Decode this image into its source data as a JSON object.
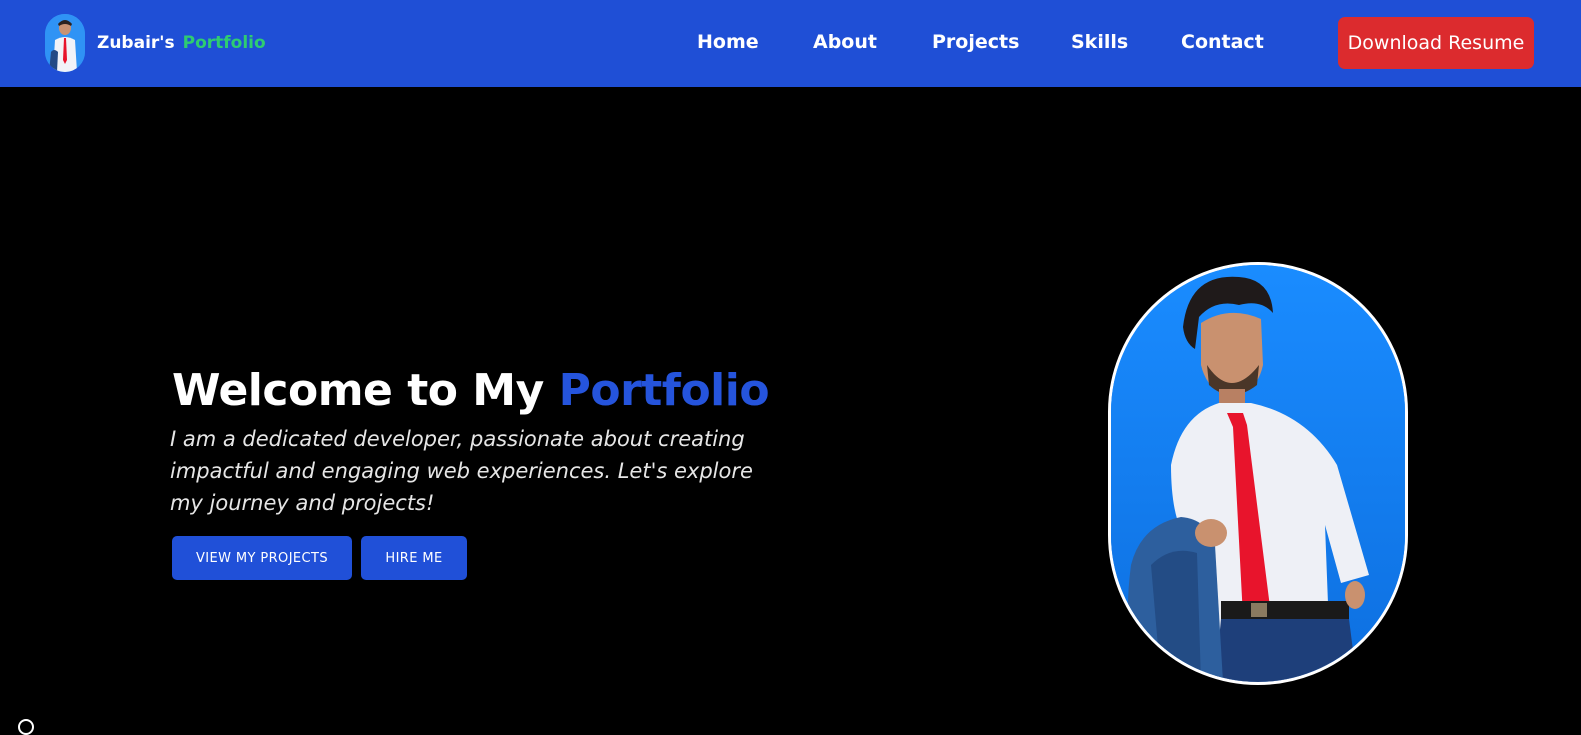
{
  "navbar": {
    "brand": {
      "owner": "Zubair's",
      "word": "Portfolio",
      "avatar_icon": "profile-avatar-icon"
    },
    "links": [
      {
        "label": "Home"
      },
      {
        "label": "About"
      },
      {
        "label": "Projects"
      },
      {
        "label": "Skills"
      },
      {
        "label": "Contact"
      }
    ],
    "resume_button": "Download Resume"
  },
  "hero": {
    "title_prefix": "Welcome to My",
    "title_accent": "Portfolio",
    "description": "I am a dedicated developer, passionate about creating impactful and engaging web experiences. Let's explore my journey and projects!",
    "buttons": {
      "projects": "VIEW MY PROJECTS",
      "hire": "HIRE ME"
    },
    "portrait_icon": "profile-photo"
  },
  "colors": {
    "navbar_bg": "#1f4fd6",
    "page_bg": "#000000",
    "brand_accent": "#2ecc71",
    "title_accent": "#2554dc",
    "resume_button_bg": "#dc2b2e",
    "cta_bg": "#2050d8"
  }
}
